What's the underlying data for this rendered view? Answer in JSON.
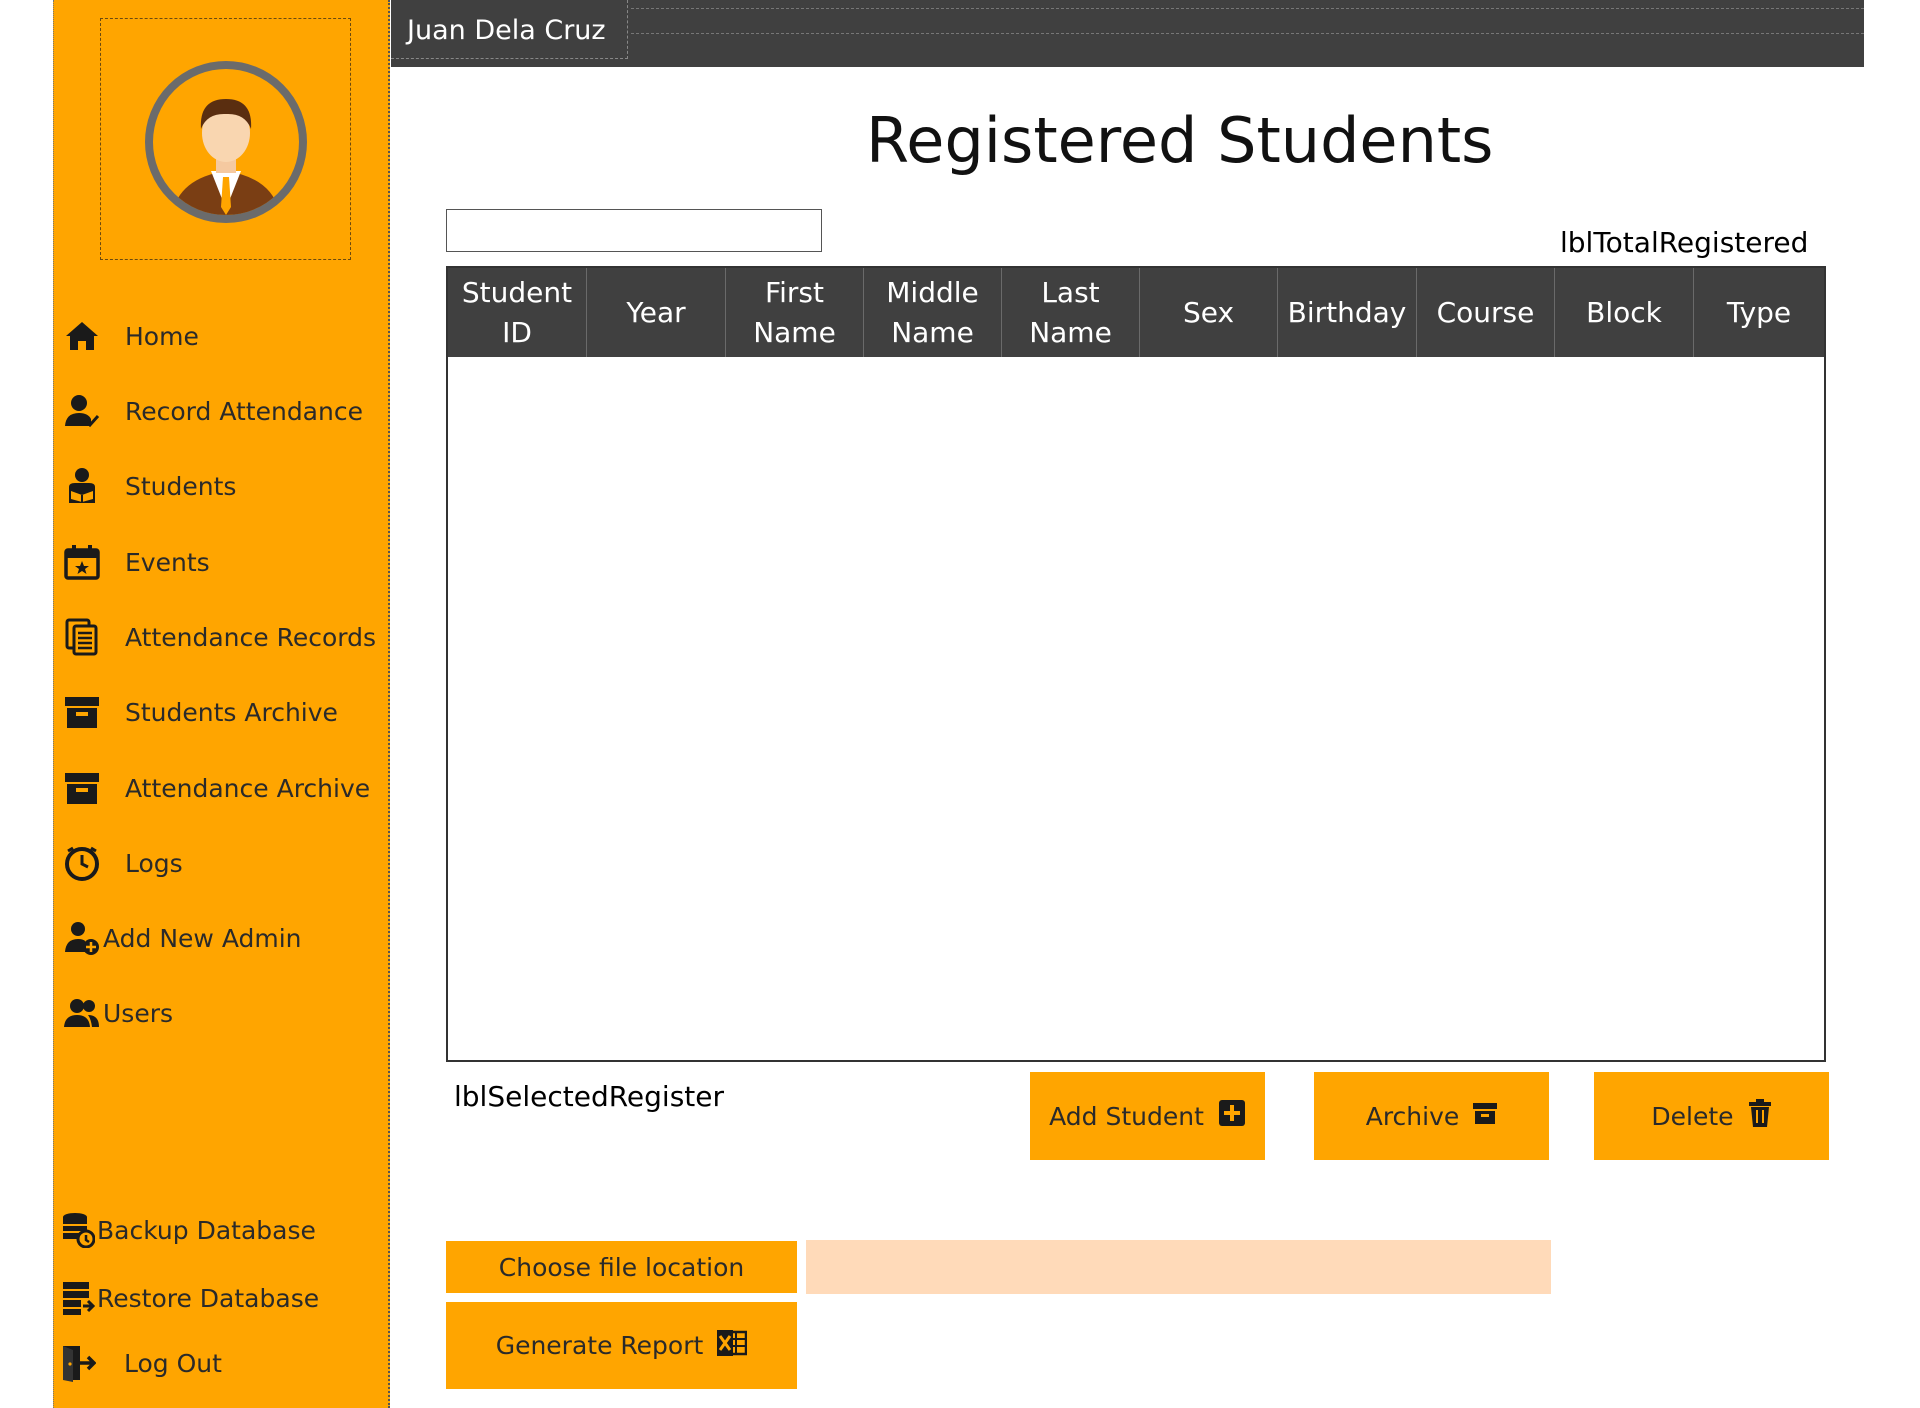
{
  "sidebar": {
    "items": [
      {
        "label": "Home",
        "icon": "home-icon"
      },
      {
        "label": "Record Attendance",
        "icon": "user-check-icon"
      },
      {
        "label": "Students",
        "icon": "student-reading-icon"
      },
      {
        "label": "Events",
        "icon": "calendar-star-icon"
      },
      {
        "label": "Attendance Records",
        "icon": "documents-icon"
      },
      {
        "label": "Students Archive",
        "icon": "archive-box-icon"
      },
      {
        "label": "Attendance Archive",
        "icon": "archive-box-icon"
      },
      {
        "label": "Logs",
        "icon": "stopwatch-icon"
      },
      {
        "label": "Add New Admin",
        "icon": "user-plus-icon"
      },
      {
        "label": "Users",
        "icon": "users-icon"
      }
    ],
    "bottom_items": [
      {
        "label": "Backup Database",
        "icon": "database-backup-icon"
      },
      {
        "label": "Restore Database",
        "icon": "database-restore-icon"
      },
      {
        "label": "Log Out",
        "icon": "logout-icon"
      }
    ]
  },
  "header": {
    "user_name": "Juan Dela Cruz"
  },
  "main": {
    "title": "Registered Students",
    "search": {
      "value": "",
      "placeholder": ""
    },
    "total_label": "lblTotalRegistered",
    "selected_label": "lblSelectedRegister",
    "table": {
      "columns": [
        "Student\nID",
        "Year",
        "First\nName",
        "Middle\nName",
        "Last\nName",
        "Sex",
        "Birthday",
        "Course",
        "Block",
        "Type"
      ],
      "rows": []
    },
    "buttons": {
      "add": "Add Student",
      "archive": "Archive",
      "delete": "Delete",
      "choose_file": "Choose file location",
      "generate": "Generate Report"
    },
    "file_path": ""
  },
  "colors": {
    "accent": "#FFA500",
    "header_dark": "#404040",
    "file_path_bg": "#FFDAB9"
  }
}
